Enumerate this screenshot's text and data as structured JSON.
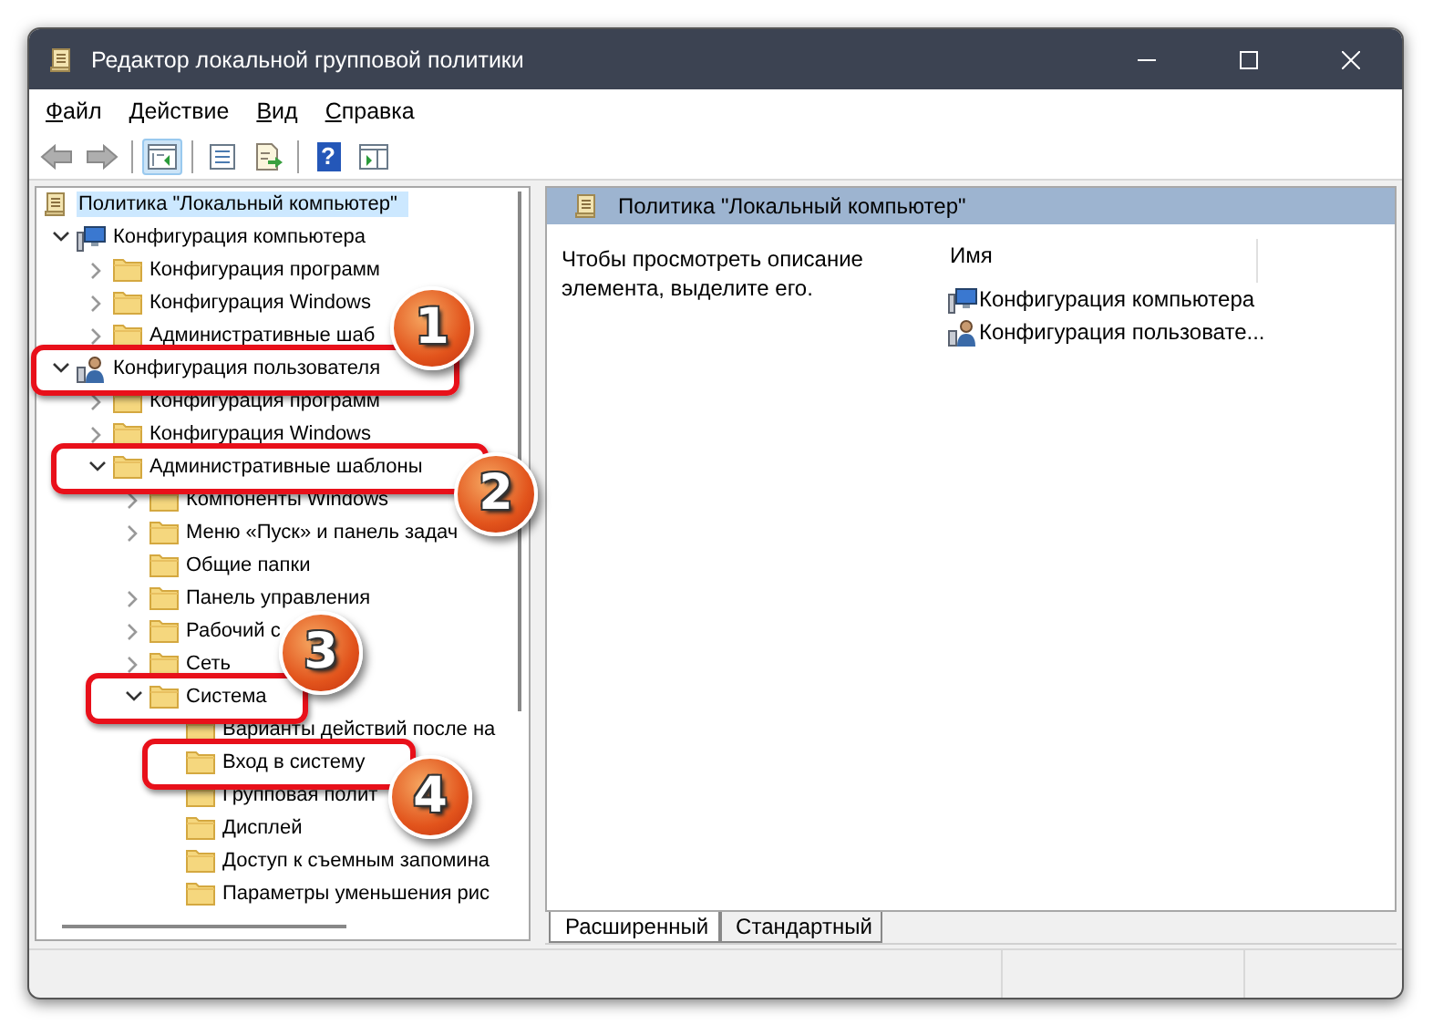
{
  "window": {
    "title": "Редактор локальной групповой политики"
  },
  "menu": [
    {
      "label": "Файл"
    },
    {
      "label": "Действие"
    },
    {
      "label": "Вид"
    },
    {
      "label": "Справка"
    }
  ],
  "toolbar": [
    {
      "kind": "back",
      "disabled": true,
      "pressed": false
    },
    {
      "kind": "forward",
      "disabled": true,
      "pressed": false
    },
    {
      "kind": "separator"
    },
    {
      "kind": "tree",
      "disabled": false,
      "pressed": true
    },
    {
      "kind": "separator"
    },
    {
      "kind": "properties",
      "disabled": false,
      "pressed": false
    },
    {
      "kind": "export",
      "disabled": false,
      "pressed": false
    },
    {
      "kind": "separator"
    },
    {
      "kind": "help",
      "glyph": "?",
      "disabled": false,
      "pressed": false
    },
    {
      "kind": "action",
      "disabled": false,
      "pressed": false
    }
  ],
  "tree": [
    {
      "label": "Политика \"Локальный компьютер\"",
      "kind": "policy",
      "selected": true,
      "children": [
        {
          "label": "Конфигурация компьютера",
          "kind": "computer",
          "expanded": true,
          "selected": false,
          "children": [
            {
              "label": "Конфигурация программ",
              "kind": "folder",
              "expanded": false,
              "selected": false
            },
            {
              "label": "Конфигурация Windows",
              "kind": "folder",
              "expanded": false,
              "selected": false
            },
            {
              "label": "Административные шаб",
              "kind": "folder",
              "expanded": false,
              "selected": false
            }
          ]
        },
        {
          "label": "Конфигурация пользователя",
          "kind": "user",
          "expanded": true,
          "selected": false,
          "children": [
            {
              "label": "Конфигурация программ",
              "kind": "folder",
              "expanded": false,
              "selected": false
            },
            {
              "label": "Конфигурация Windows",
              "kind": "folder",
              "expanded": false,
              "selected": false
            },
            {
              "label": "Административные шаблоны",
              "kind": "folder",
              "expanded": true,
              "selected": false,
              "children": [
                {
                  "label": "Компоненты Windows",
                  "kind": "folder",
                  "expanded": false,
                  "selected": false
                },
                {
                  "label": "Меню «Пуск» и панель задач",
                  "kind": "folder",
                  "expanded": false,
                  "selected": false
                },
                {
                  "label": "Общие папки",
                  "kind": "folder",
                  "selected": false
                },
                {
                  "label": "Панель управления",
                  "kind": "folder",
                  "expanded": false,
                  "selected": false
                },
                {
                  "label": "Рабочий с",
                  "kind": "folder",
                  "expanded": false,
                  "selected": false
                },
                {
                  "label": "Сеть",
                  "kind": "folder",
                  "expanded": false,
                  "selected": false
                },
                {
                  "label": "Система",
                  "kind": "folder",
                  "expanded": true,
                  "selected": false,
                  "children": [
                    {
                      "label": "Варианты действий после на",
                      "kind": "folder",
                      "selected": false
                    },
                    {
                      "label": "Вход в систему",
                      "kind": "folder",
                      "selected": false
                    },
                    {
                      "label": "Групповая полит",
                      "kind": "folder",
                      "selected": false
                    },
                    {
                      "label": "Дисплей",
                      "kind": "folder",
                      "selected": false
                    },
                    {
                      "label": "Доступ к съемным запомина",
                      "kind": "folder",
                      "selected": false
                    },
                    {
                      "label": "Параметры уменьшения рис",
                      "kind": "folder",
                      "selected": false
                    }
                  ]
                }
              ]
            }
          ]
        }
      ]
    }
  ],
  "details": {
    "title": "Политика \"Локальный компьютер\"",
    "description": "Чтобы просмотреть описание элемента, выделите его.",
    "column": "Имя",
    "items": [
      {
        "label": "Конфигурация компьютера",
        "kind": "computer"
      },
      {
        "label": "Конфигурация пользовате...",
        "kind": "user"
      }
    ]
  },
  "view_tabs": [
    {
      "label": "Расширенный",
      "selected": true
    },
    {
      "label": "Стандартный",
      "selected": false
    }
  ],
  "callouts": [
    {
      "number": "1"
    },
    {
      "number": "2"
    },
    {
      "number": "3"
    },
    {
      "number": "4"
    }
  ]
}
